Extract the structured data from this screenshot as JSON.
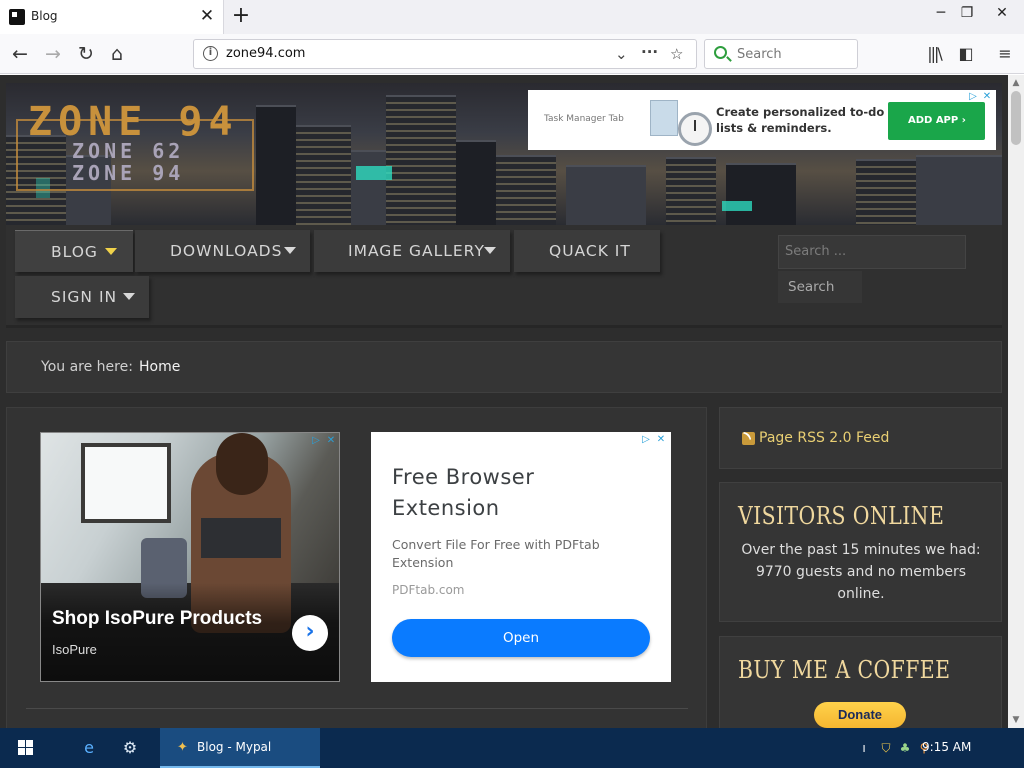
{
  "browser": {
    "tab": {
      "title": "Blog"
    },
    "window_controls": {
      "minimize": "─",
      "maximize": "❐",
      "close": "✕"
    },
    "url": "zone94.com",
    "search_placeholder": "Search",
    "icons": [
      "back-icon",
      "forward-icon",
      "reload-icon",
      "home-icon",
      "info-icon",
      "dropdown-icon",
      "page-actions-icon",
      "bookmark-star-icon",
      "library-icon",
      "sidebar-icon",
      "menu-icon"
    ]
  },
  "site": {
    "logo": {
      "main": "ZONE 94",
      "sub1": "ZONE 62",
      "sub2": "ZONE 94"
    },
    "top_ad": {
      "brand": "Task Manager Tab",
      "copy": "Create personalized to-do lists & reminders.",
      "button": "ADD APP"
    },
    "menu": [
      {
        "label": "BLOG",
        "dropdown": true
      },
      {
        "label": "DOWNLOADS",
        "dropdown": true
      },
      {
        "label": "IMAGE GALLERY",
        "dropdown": true
      },
      {
        "label": "QUACK IT",
        "dropdown": false
      },
      {
        "label": "SIGN IN",
        "dropdown": true
      }
    ],
    "search": {
      "placeholder": "Search ...",
      "button": "Search"
    },
    "breadcrumb": {
      "prefix": "You are here:",
      "home": "Home"
    },
    "ad_isopure": {
      "title": "Shop IsoPure Products",
      "brand": "IsoPure"
    },
    "ad_pdftab": {
      "title": "Free Browser Extension",
      "description": "Convert File For Free with PDFtab Extension",
      "url": "PDFtab.com",
      "button": "Open"
    },
    "sidebar": {
      "rss": "Page RSS 2.0 Feed",
      "visitors_heading": "VISITORS ONLINE",
      "visitors_text": "Over the past 15 minutes we had: 9770 guests and no members online.",
      "coffee_heading": "BUY ME A COFFEE",
      "donate": "Donate"
    }
  },
  "taskbar": {
    "active_window": "Blog - Mypal",
    "clock": "9:15 AM"
  },
  "colors": {
    "page_bg": "#2d2d2d",
    "menu_caret_active": "#f0d24a",
    "rss_link": "#e9cf73",
    "sidebar_heading": "#f0d89e",
    "ad_button_green": "#1aa64a",
    "ad_button_blue": "#0a7bff",
    "taskbar": "#0b2a4f"
  }
}
